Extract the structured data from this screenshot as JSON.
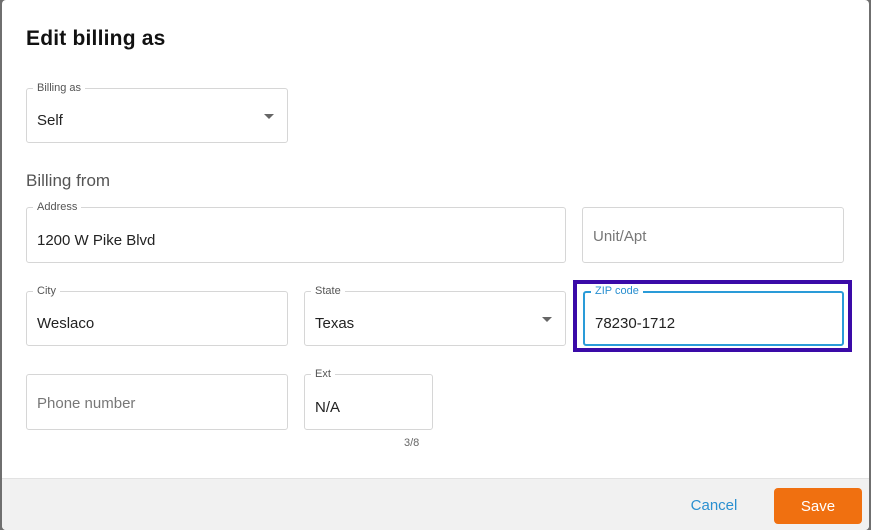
{
  "dialog": {
    "title": "Edit billing as"
  },
  "billing_as": {
    "label": "Billing as",
    "value": "Self"
  },
  "section": {
    "billing_from": "Billing from"
  },
  "address": {
    "label": "Address",
    "value": "1200 W Pike Blvd"
  },
  "unit": {
    "placeholder": "Unit/Apt"
  },
  "city": {
    "label": "City",
    "value": "Weslaco"
  },
  "state": {
    "label": "State",
    "value": "Texas"
  },
  "zip": {
    "label": "ZIP code",
    "value": "78230-1712"
  },
  "phone": {
    "placeholder": "Phone number"
  },
  "ext": {
    "label": "Ext",
    "value": "N/A",
    "counter": "3/8"
  },
  "actions": {
    "cancel": "Cancel",
    "save": "Save"
  },
  "colors": {
    "primary": "#f07010",
    "link": "#2a8fd0",
    "focus": "#2a9bd8",
    "highlight": "#3a0aa8"
  }
}
